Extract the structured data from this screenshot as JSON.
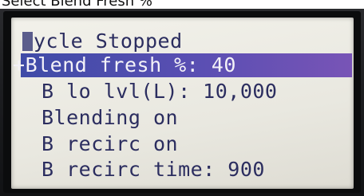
{
  "caption": "Select Blend Fresh %",
  "lcd": {
    "cursor": "C",
    "status_rest": "ycle Stopped",
    "menu_marker": "+",
    "menu": [
      {
        "text": "Blend fresh %: 40",
        "selected": true
      },
      {
        "text": "B lo lvl(L): 10,000",
        "selected": false
      },
      {
        "text": "Blending on",
        "selected": false
      },
      {
        "text": "B recirc on",
        "selected": false
      },
      {
        "text": "B recirc time: 900",
        "selected": false
      }
    ]
  },
  "colors": {
    "lcd_background": "#ebeae2",
    "lcd_text": "#2b2d5f",
    "highlight": "#5b4fb3",
    "bezel": "#1c1d20"
  }
}
